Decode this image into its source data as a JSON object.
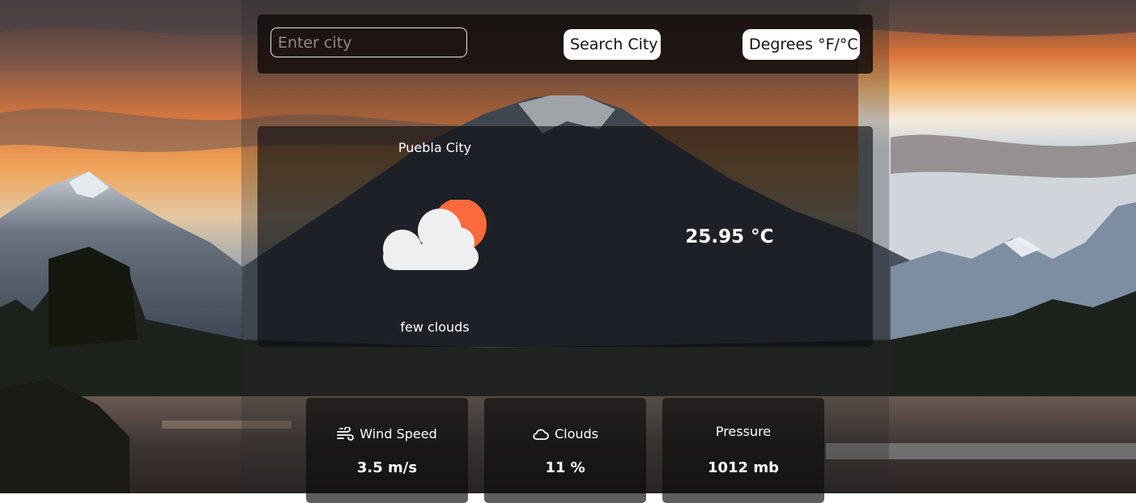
{
  "search": {
    "placeholder": "Enter city",
    "value": "",
    "search_button_label": "Search City",
    "units_button_label": "Degrees °F/°C"
  },
  "weather": {
    "city": "Puebla City",
    "description": "few clouds",
    "temperature": "25.95 °C",
    "icon": "few-clouds-icon"
  },
  "stats": {
    "wind": {
      "label": "Wind Speed",
      "value": "3.5 m/s",
      "icon": "wind-icon"
    },
    "clouds": {
      "label": "Clouds",
      "value": "11 %",
      "icon": "cloud-icon"
    },
    "pressure": {
      "label": "Pressure",
      "value": "1012 mb"
    }
  },
  "colors": {
    "sun": "#fa6a3c",
    "cloud": "#efefef",
    "panel": "#140e0c",
    "text": "#ffffff"
  }
}
